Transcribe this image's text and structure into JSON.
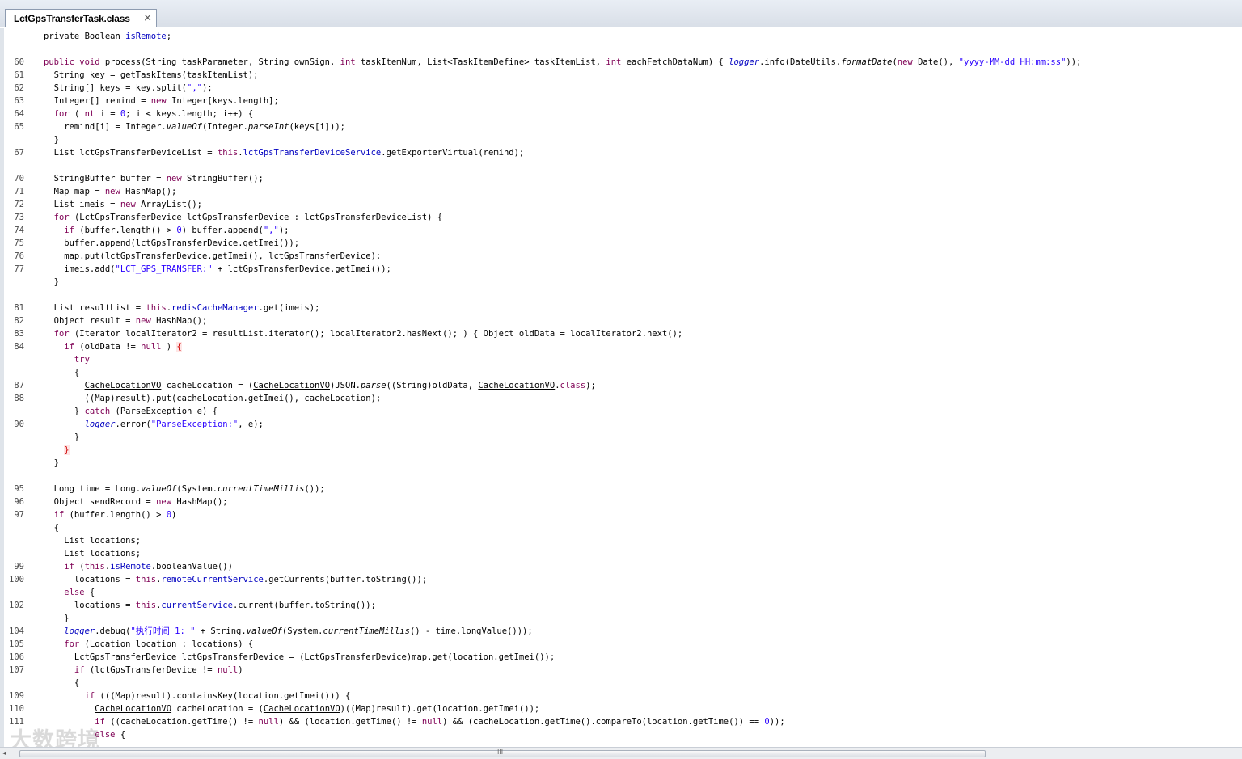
{
  "tab": {
    "title": "LctGpsTransferTask.class",
    "close": "×"
  },
  "watermark": "大数跨境",
  "scrollbar": {
    "left_arrow": "◂",
    "grip": "III"
  },
  "lines": [
    {
      "n": "",
      "segs": [
        [
          "",
          "private Boolean "
        ],
        [
          "fld",
          "isRemote"
        ],
        [
          "",
          ";"
        ]
      ]
    },
    {
      "n": "",
      "segs": []
    },
    {
      "n": "60",
      "segs": [
        [
          "kw",
          "public void "
        ],
        [
          "",
          "process(String taskParameter, String ownSign, "
        ],
        [
          "kw",
          "int "
        ],
        [
          "",
          "taskItemNum, List<TaskItemDefine> taskItemList, "
        ],
        [
          "kw",
          "int "
        ],
        [
          "",
          "eachFetchDataNum) { "
        ],
        [
          "fld it",
          "logger"
        ],
        [
          "",
          ".info(DateUtils."
        ],
        [
          "it",
          "formatDate"
        ],
        [
          "",
          "("
        ],
        [
          "kw",
          "new "
        ],
        [
          "",
          "Date(), "
        ],
        [
          "str",
          "\"yyyy-MM-dd HH:mm:ss\""
        ],
        [
          "",
          "));"
        ]
      ]
    },
    {
      "n": "61",
      "segs": [
        [
          "",
          "  String key = getTaskItems(taskItemList);"
        ]
      ]
    },
    {
      "n": "62",
      "segs": [
        [
          "",
          "  String[] keys = key.split("
        ],
        [
          "str",
          "\",\""
        ],
        [
          "",
          ");"
        ]
      ]
    },
    {
      "n": "63",
      "segs": [
        [
          "",
          "  Integer[] remind = "
        ],
        [
          "kw",
          "new "
        ],
        [
          "",
          "Integer[keys.length];"
        ]
      ]
    },
    {
      "n": "64",
      "segs": [
        [
          "kw",
          "  for "
        ],
        [
          "",
          "("
        ],
        [
          "kw",
          "int "
        ],
        [
          "",
          "i = "
        ],
        [
          "num",
          "0"
        ],
        [
          "",
          "; i < keys.length; i++) {"
        ]
      ]
    },
    {
      "n": "65",
      "segs": [
        [
          "",
          "    remind[i] = Integer."
        ],
        [
          "it",
          "valueOf"
        ],
        [
          "",
          "(Integer."
        ],
        [
          "it",
          "parseInt"
        ],
        [
          "",
          "(keys[i]));"
        ]
      ]
    },
    {
      "n": "",
      "segs": [
        [
          "",
          "  }"
        ]
      ]
    },
    {
      "n": "67",
      "segs": [
        [
          "",
          "  List lctGpsTransferDeviceList = "
        ],
        [
          "kw",
          "this"
        ],
        [
          "",
          "."
        ],
        [
          "fld",
          "lctGpsTransferDeviceService"
        ],
        [
          "",
          ".getExporterVirtual(remind);"
        ]
      ]
    },
    {
      "n": "",
      "segs": []
    },
    {
      "n": "70",
      "segs": [
        [
          "",
          "  StringBuffer buffer = "
        ],
        [
          "kw",
          "new "
        ],
        [
          "",
          "StringBuffer();"
        ]
      ]
    },
    {
      "n": "71",
      "segs": [
        [
          "",
          "  Map map = "
        ],
        [
          "kw",
          "new "
        ],
        [
          "",
          "HashMap();"
        ]
      ]
    },
    {
      "n": "72",
      "segs": [
        [
          "",
          "  List imeis = "
        ],
        [
          "kw",
          "new "
        ],
        [
          "",
          "ArrayList();"
        ]
      ]
    },
    {
      "n": "73",
      "segs": [
        [
          "kw",
          "  for "
        ],
        [
          "",
          "(LctGpsTransferDevice lctGpsTransferDevice : lctGpsTransferDeviceList) {"
        ]
      ]
    },
    {
      "n": "74",
      "segs": [
        [
          "kw",
          "    if "
        ],
        [
          "",
          "(buffer.length() > "
        ],
        [
          "num",
          "0"
        ],
        [
          "",
          ") buffer.append("
        ],
        [
          "str",
          "\",\""
        ],
        [
          "",
          ");"
        ]
      ]
    },
    {
      "n": "75",
      "segs": [
        [
          "",
          "    buffer.append(lctGpsTransferDevice.getImei());"
        ]
      ]
    },
    {
      "n": "76",
      "segs": [
        [
          "",
          "    map.put(lctGpsTransferDevice.getImei(), lctGpsTransferDevice);"
        ]
      ]
    },
    {
      "n": "77",
      "segs": [
        [
          "",
          "    imeis.add("
        ],
        [
          "str",
          "\"LCT_GPS_TRANSFER:\""
        ],
        [
          "",
          " + lctGpsTransferDevice.getImei());"
        ]
      ]
    },
    {
      "n": "",
      "segs": [
        [
          "",
          "  }"
        ]
      ]
    },
    {
      "n": "",
      "segs": []
    },
    {
      "n": "81",
      "segs": [
        [
          "",
          "  List resultList = "
        ],
        [
          "kw",
          "this"
        ],
        [
          "",
          "."
        ],
        [
          "fld",
          "redisCacheManager"
        ],
        [
          "",
          ".get(imeis);"
        ]
      ]
    },
    {
      "n": "82",
      "segs": [
        [
          "",
          "  Object result = "
        ],
        [
          "kw",
          "new "
        ],
        [
          "",
          "HashMap();"
        ]
      ]
    },
    {
      "n": "83",
      "segs": [
        [
          "kw",
          "  for "
        ],
        [
          "",
          "(Iterator localIterator2 = resultList.iterator(); localIterator2.hasNext(); ) { Object oldData = localIterator2.next();"
        ]
      ]
    },
    {
      "n": "84",
      "segs": [
        [
          "kw",
          "    if "
        ],
        [
          "",
          "(oldData != "
        ],
        [
          "kw",
          "null"
        ],
        [
          "",
          " ) "
        ],
        [
          "err",
          "{"
        ]
      ]
    },
    {
      "n": "",
      "segs": [
        [
          "kw",
          "      try"
        ]
      ]
    },
    {
      "n": "",
      "segs": [
        [
          "",
          "      {"
        ]
      ]
    },
    {
      "n": "87",
      "segs": [
        [
          "",
          "        "
        ],
        [
          "u",
          "CacheLocationVO"
        ],
        [
          "",
          " cacheLocation = ("
        ],
        [
          "u",
          "CacheLocationVO"
        ],
        [
          "",
          ")JSON."
        ],
        [
          "it",
          "parse"
        ],
        [
          "",
          "((String)oldData, "
        ],
        [
          "u",
          "CacheLocationVO"
        ],
        [
          "",
          "."
        ],
        [
          "kw",
          "class"
        ],
        [
          "",
          ");"
        ]
      ]
    },
    {
      "n": "88",
      "segs": [
        [
          "",
          "        ((Map)result).put(cacheLocation.getImei(), cacheLocation);"
        ]
      ]
    },
    {
      "n": "",
      "segs": [
        [
          "",
          "      } "
        ],
        [
          "kw",
          "catch "
        ],
        [
          "",
          "(ParseException e) {"
        ]
      ]
    },
    {
      "n": "90",
      "segs": [
        [
          "",
          "        "
        ],
        [
          "fld it",
          "logger"
        ],
        [
          "",
          ".error("
        ],
        [
          "str",
          "\"ParseException:\""
        ],
        [
          "",
          ", e);"
        ]
      ]
    },
    {
      "n": "",
      "segs": [
        [
          "",
          "      }"
        ]
      ]
    },
    {
      "n": "",
      "segs": [
        [
          "",
          "    "
        ],
        [
          "err",
          "}"
        ]
      ]
    },
    {
      "n": "",
      "segs": [
        [
          "",
          "  }"
        ]
      ]
    },
    {
      "n": "",
      "segs": []
    },
    {
      "n": "95",
      "segs": [
        [
          "",
          "  Long time = Long."
        ],
        [
          "it",
          "valueOf"
        ],
        [
          "",
          "(System."
        ],
        [
          "it",
          "currentTimeMillis"
        ],
        [
          "",
          "());"
        ]
      ]
    },
    {
      "n": "96",
      "segs": [
        [
          "",
          "  Object sendRecord = "
        ],
        [
          "kw",
          "new "
        ],
        [
          "",
          "HashMap();"
        ]
      ]
    },
    {
      "n": "97",
      "segs": [
        [
          "kw",
          "  if "
        ],
        [
          "",
          "(buffer.length() > "
        ],
        [
          "num",
          "0"
        ],
        [
          "",
          ")"
        ]
      ]
    },
    {
      "n": "",
      "segs": [
        [
          "",
          "  {"
        ]
      ]
    },
    {
      "n": "",
      "segs": [
        [
          "",
          "    List locations;"
        ]
      ]
    },
    {
      "n": "",
      "segs": [
        [
          "",
          "    List locations;"
        ]
      ]
    },
    {
      "n": "99",
      "segs": [
        [
          "kw",
          "    if "
        ],
        [
          "",
          "("
        ],
        [
          "kw",
          "this"
        ],
        [
          "",
          "."
        ],
        [
          "fld",
          "isRemote"
        ],
        [
          "",
          ".booleanValue())"
        ]
      ]
    },
    {
      "n": "100",
      "segs": [
        [
          "",
          "      locations = "
        ],
        [
          "kw",
          "this"
        ],
        [
          "",
          "."
        ],
        [
          "fld",
          "remoteCurrentService"
        ],
        [
          "",
          ".getCurrents(buffer.toString());"
        ]
      ]
    },
    {
      "n": "",
      "segs": [
        [
          "kw",
          "    else "
        ],
        [
          "",
          "{"
        ]
      ]
    },
    {
      "n": "102",
      "segs": [
        [
          "",
          "      locations = "
        ],
        [
          "kw",
          "this"
        ],
        [
          "",
          "."
        ],
        [
          "fld",
          "currentService"
        ],
        [
          "",
          ".current(buffer.toString());"
        ]
      ]
    },
    {
      "n": "",
      "segs": [
        [
          "",
          "    }"
        ]
      ]
    },
    {
      "n": "104",
      "segs": [
        [
          "",
          "    "
        ],
        [
          "fld it",
          "logger"
        ],
        [
          "",
          ".debug("
        ],
        [
          "str",
          "\"执行时间 1: \""
        ],
        [
          "",
          " + String."
        ],
        [
          "it",
          "valueOf"
        ],
        [
          "",
          "(System."
        ],
        [
          "it",
          "currentTimeMillis"
        ],
        [
          "",
          "() - time.longValue()));"
        ]
      ]
    },
    {
      "n": "105",
      "segs": [
        [
          "kw",
          "    for "
        ],
        [
          "",
          "(Location location : locations) {"
        ]
      ]
    },
    {
      "n": "106",
      "segs": [
        [
          "",
          "      LctGpsTransferDevice lctGpsTransferDevice = (LctGpsTransferDevice)map.get(location.getImei());"
        ]
      ]
    },
    {
      "n": "107",
      "segs": [
        [
          "kw",
          "      if "
        ],
        [
          "",
          "(lctGpsTransferDevice != "
        ],
        [
          "kw",
          "null"
        ],
        [
          "",
          ")"
        ]
      ]
    },
    {
      "n": "",
      "segs": [
        [
          "",
          "      {"
        ]
      ]
    },
    {
      "n": "109",
      "segs": [
        [
          "kw",
          "        if "
        ],
        [
          "",
          "(((Map)result).containsKey(location.getImei())) {"
        ]
      ]
    },
    {
      "n": "110",
      "segs": [
        [
          "",
          "          "
        ],
        [
          "u",
          "CacheLocationVO"
        ],
        [
          "",
          " cacheLocation = ("
        ],
        [
          "u",
          "CacheLocationVO"
        ],
        [
          "",
          ")((Map)result).get(location.getImei());"
        ]
      ]
    },
    {
      "n": "111",
      "segs": [
        [
          "kw",
          "          if "
        ],
        [
          "",
          "((cacheLocation.getTime() != "
        ],
        [
          "kw",
          "null"
        ],
        [
          "",
          ") && (location.getTime() != "
        ],
        [
          "kw",
          "null"
        ],
        [
          "",
          ") && (cacheLocation.getTime().compareTo(location.getTime()) == "
        ],
        [
          "num",
          "0"
        ],
        [
          "",
          "));"
        ]
      ]
    },
    {
      "n": "",
      "segs": [
        [
          "kw",
          "          else "
        ],
        [
          "",
          "{"
        ]
      ]
    }
  ]
}
